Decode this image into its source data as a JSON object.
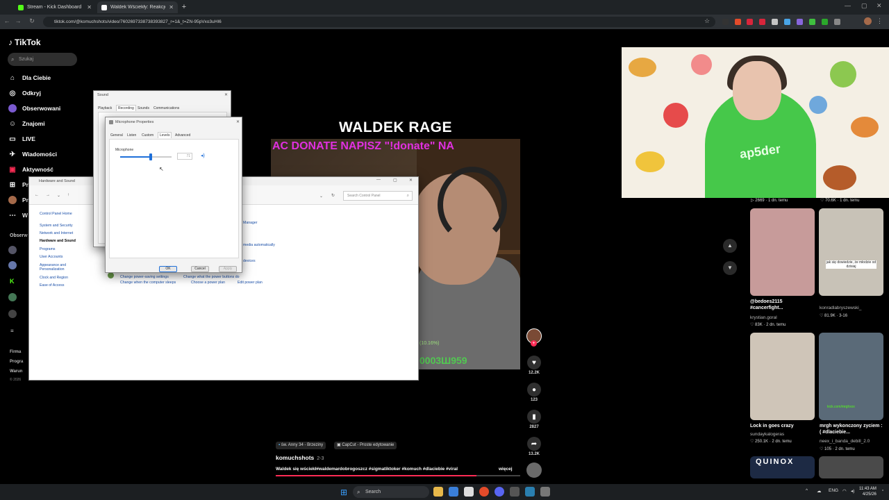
{
  "browser": {
    "tabs": [
      {
        "label": "Stream - Kick Dashboard",
        "favicon_color": "#53fc18"
      },
      {
        "label": "Waldek Wściekły: Reakcje na W...",
        "favicon_color": "#ffffff"
      }
    ],
    "url": "tiktok.com/@komuchshots/video/7602697338738393827_r=1&_t=ZN-95pVxo3uHI6"
  },
  "sidebar": {
    "brand": "TikTok",
    "search_placeholder": "Szukaj",
    "items": [
      {
        "label": "Dla Ciebie",
        "icon": "home-icon"
      },
      {
        "label": "Odkryj",
        "icon": "compass-icon"
      },
      {
        "label": "Obserwowani",
        "icon": "following-icon"
      },
      {
        "label": "Znajomi",
        "icon": "friends-icon"
      },
      {
        "label": "LIVE",
        "icon": "live-icon"
      },
      {
        "label": "Wiadomości",
        "icon": "messages-icon"
      },
      {
        "label": "Aktywność",
        "icon": "activity-icon"
      }
    ],
    "partial_items": [
      "Pr",
      "Pr",
      "W"
    ],
    "following_header": "Obserw",
    "footer": [
      "Firma",
      "Progra",
      "Warun",
      "© 2026"
    ]
  },
  "video": {
    "title": "WALDEK RAGE",
    "marquee": "AC DONATE NAPISZ \"!donate\" NA",
    "overlay_percent": "(10.16%)",
    "overlay_green": "0003Ш959"
  },
  "actions": {
    "likes": "12.2K",
    "comments": "123",
    "saves": "2827",
    "shares": "13.2K"
  },
  "caption": {
    "tags": [
      "św. Anny 34 - Brzeziny",
      "CapCut - Proste edytowanie"
    ],
    "author": "komuchshots",
    "date": "2-3",
    "description": "Waldek się wściekł#waldemardobrogoszcz #sigmatiktoker #komuch #dlaciebie #viral",
    "more": "więcej",
    "progress": 0.82
  },
  "webcam": {
    "hoodie_text": "ap5der"
  },
  "recommendations": {
    "top_stats": [
      {
        "likes": "2669",
        "date": "1 dn. temu"
      },
      {
        "likes": "70.6K",
        "date": "1 dn. temu"
      }
    ],
    "items": [
      {
        "title": "@bedoes2115 #cancerfight...",
        "user": "krystian.goral",
        "likes": "83K",
        "date": "2 dn. temu",
        "thumb": "#c79b9a"
      },
      {
        "title": "",
        "user": "konradlabryszewski_",
        "likes": "81.9K",
        "date": "3-16",
        "thumb": "#c8c2b7",
        "thumb_caption": "jak się dowiedzie, że młodzie od dzisiaj"
      },
      {
        "title": "Lock in goes crazy",
        "user": "sundaykalogeras",
        "likes": "250.1K",
        "date": "2 dn. temu",
        "thumb": "#cfc5b8"
      },
      {
        "title": "mrgh wykonczony zyciem :( #dlaciebie...",
        "user": "neex_i_banda_debill_2.0",
        "likes": "105",
        "date": "2 dn. temu",
        "thumb": "#5a6a78",
        "thumb_caption": "kick.com/mrghxxx"
      },
      {
        "title": "",
        "user": "",
        "likes": "",
        "date": "",
        "thumb": "#1d2a44",
        "thumb_caption": "QUINOX"
      }
    ]
  },
  "sound_dialog": {
    "title": "Sound",
    "tabs": [
      "Playback",
      "Recording",
      "Sounds",
      "Communications"
    ]
  },
  "mic_dialog": {
    "title": "Microphone Properties",
    "tabs": [
      "General",
      "Listen",
      "Custom",
      "Levels",
      "Advanced"
    ],
    "section": "Microphone",
    "level": 0.6,
    "level_value": "71",
    "buttons": [
      "OK",
      "Cancel",
      "Apply"
    ]
  },
  "control_panel": {
    "title": "Hardware and Sound",
    "search_placeholder": "Search Control Panel",
    "left_items": [
      "Control Panel Home",
      "System and Security",
      "Network and Internet",
      "Hardware and Sound",
      "Programs",
      "User Accounts",
      "Appearance and Personalization",
      "Clock and Region",
      "Ease of Access"
    ],
    "links": [
      "Manager",
      "media automatically",
      "devices",
      "Change power-saving settings",
      "Change what the power buttons do",
      "Change when the computer sleeps",
      "Choose a power plan",
      "Edit power plan"
    ]
  },
  "taskbar": {
    "search": "Search",
    "lang": "ENG",
    "time": "11:43 AM",
    "date": "4/25/26"
  }
}
